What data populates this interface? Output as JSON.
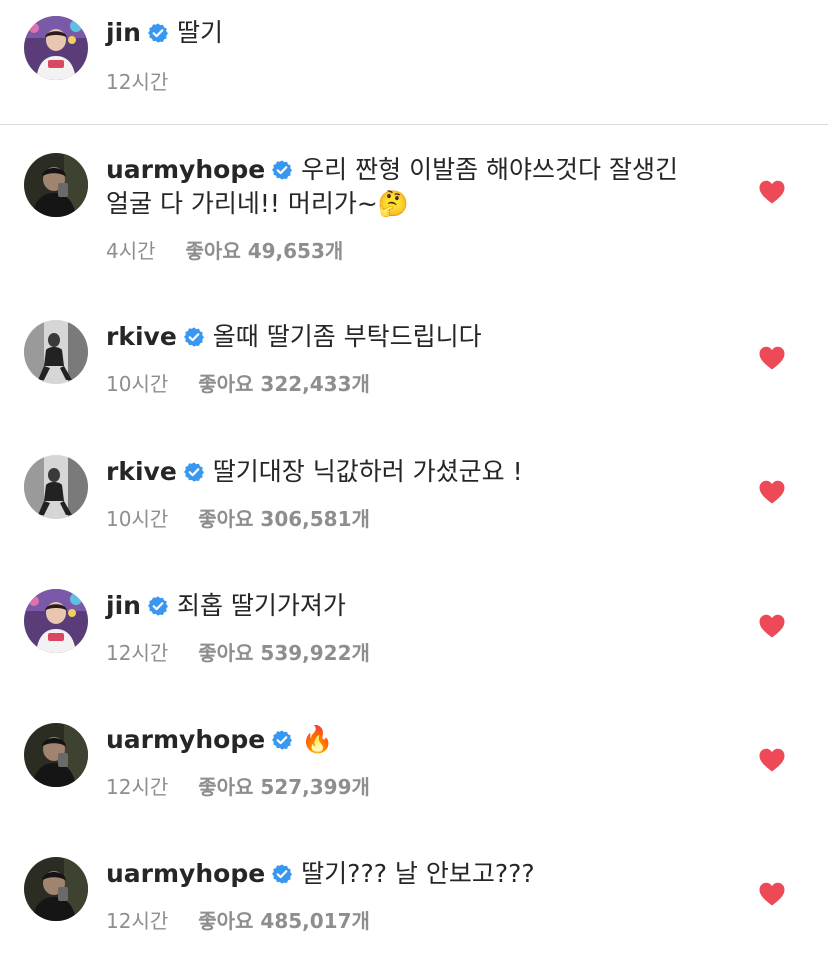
{
  "colors": {
    "verified": "#3897f0",
    "heart": "#ed4956",
    "meta": "#8e8e8e",
    "text": "#262626",
    "divider": "#dbdbdb"
  },
  "caption": {
    "username": "jin",
    "text": "딸기",
    "time": "12시간",
    "avatar_icon": "avatar-jin-icon"
  },
  "comments": [
    {
      "username": "uarmyhope",
      "text_line1": "우리 짠형 이발좀 해야쓰것다 잘생긴",
      "text_line2": "얼굴 다 가리네!! 머리가~🤔",
      "time": "4시간",
      "likes": "좋아요 49,653개",
      "liked": true
    },
    {
      "username": "rkive",
      "text_line1": "올때 딸기좀 부탁드립니다",
      "time": "10시간",
      "likes": "좋아요 322,433개",
      "liked": true
    },
    {
      "username": "rkive",
      "text_line1": "딸기대장 닉값하러 가셨군요 !",
      "time": "10시간",
      "likes": "좋아요 306,581개",
      "liked": true
    },
    {
      "username": "jin",
      "text_line1": "죄홉 딸기가져가",
      "time": "12시간",
      "likes": "좋아요 539,922개",
      "liked": true
    },
    {
      "username": "uarmyhope",
      "text_line1": "🔥",
      "time": "12시간",
      "likes": "좋아요 527,399개",
      "liked": true
    },
    {
      "username": "uarmyhope",
      "text_line1": "딸기??? 날 안보고???",
      "time": "12시간",
      "likes": "좋아요 485,017개",
      "liked": true
    }
  ]
}
